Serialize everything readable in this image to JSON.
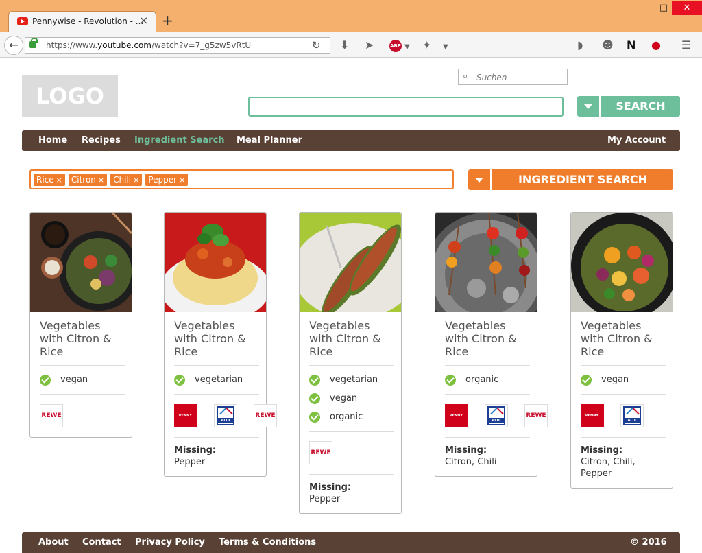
{
  "browser": {
    "tab_title": "Pennywise - Revolution - ...",
    "url_prefix": "https://www.",
    "url_domain": "youtube.com",
    "url_path": "/watch?v=7_g5zw5vRtU",
    "search_placeholder": "Suchen",
    "new_tab": "+",
    "window_min": "–",
    "window_max": "□",
    "window_close": "✕"
  },
  "header": {
    "logo_text": "LOGO",
    "search_value": "",
    "search_button": "SEARCH"
  },
  "nav": {
    "items": [
      "Home",
      "Recipes",
      "Ingredient Search",
      "Meal Planner"
    ],
    "active": "Ingredient Search",
    "account": "My Account"
  },
  "ingredient_search": {
    "tags": [
      "Rice",
      "Citron",
      "Chili",
      "Pepper"
    ],
    "remove_glyph": "×",
    "button": "INGREDIENT SEARCH"
  },
  "recipes": [
    {
      "title": "Vegetables with Citron & Rice",
      "labels": [
        "vegan"
      ],
      "stores": [
        "REWE"
      ],
      "missing": ""
    },
    {
      "title": "Vegetables with Citron & Rice",
      "labels": [
        "vegetarian"
      ],
      "stores": [
        "PENNY",
        "ALDI",
        "REWE"
      ],
      "missing_heading": "Missing:",
      "missing": "Pepper"
    },
    {
      "title": "Vegetables with Citron & Rice",
      "labels": [
        "vegetarian",
        "vegan",
        "organic"
      ],
      "stores": [
        "REWE"
      ],
      "missing_heading": "Missing:",
      "missing": "Pepper"
    },
    {
      "title": "Vegetables with Citron & Rice",
      "labels": [
        "organic"
      ],
      "stores": [
        "PENNY",
        "ALDI",
        "REWE"
      ],
      "missing_heading": "Missing:",
      "missing": "Citron, Chili"
    },
    {
      "title": "Vegetables with Citron & Rice",
      "labels": [
        "vegan"
      ],
      "stores": [
        "PENNY",
        "ALDI"
      ],
      "missing_heading": "Missing:",
      "missing": "Citron, Chili, Pepper"
    }
  ],
  "store_logos": {
    "penny": "PENNY.",
    "rewe": "REWE",
    "aldi": "ALDI"
  },
  "footer": {
    "links": [
      "About",
      "Contact",
      "Privacy Policy",
      "Terms & Conditions"
    ],
    "copyright": "© 2016"
  },
  "colors": {
    "accent_green": "#6dbf9b",
    "accent_orange": "#f07d2c",
    "nav_brown": "#5a4135",
    "check_green": "#7ec040"
  }
}
